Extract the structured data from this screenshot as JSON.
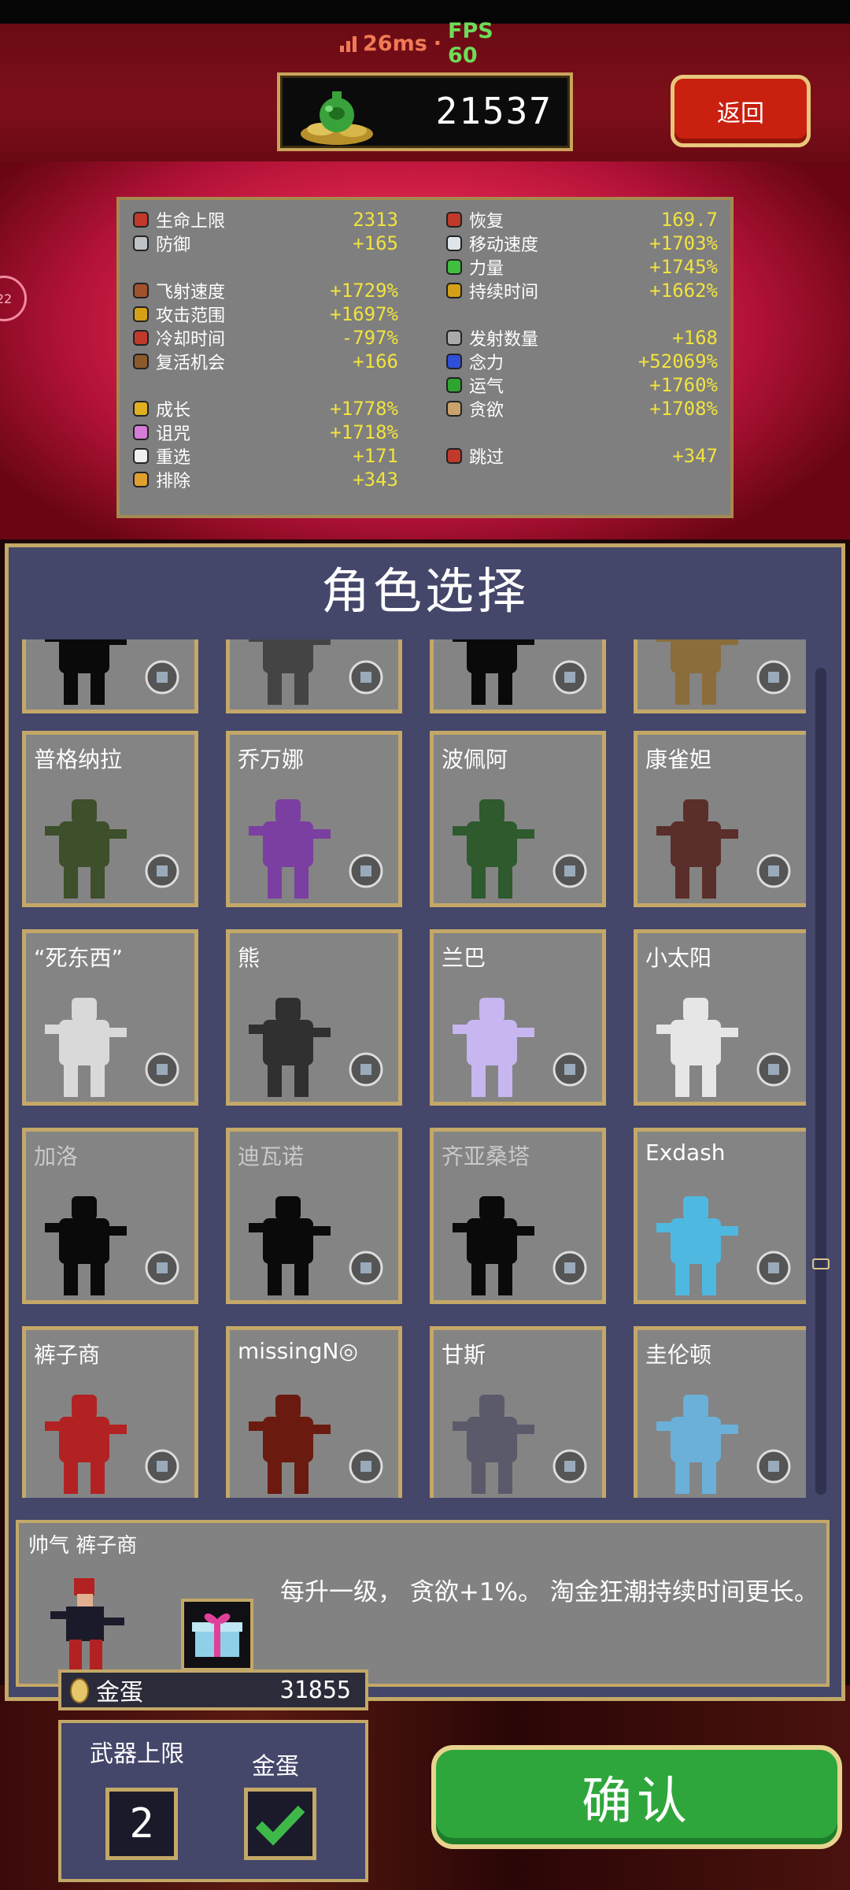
{
  "status": {
    "ping": "26ms",
    "separator": "·",
    "fps": "FPS 60"
  },
  "header": {
    "gold": "21537",
    "back_label": "返回"
  },
  "side_indicator": "22",
  "stats": {
    "left": [
      {
        "label": "生命上限",
        "value": "2313",
        "icon": "heart-cage-icon"
      },
      {
        "label": "防御",
        "value": "+165",
        "icon": "armor-icon"
      },
      {
        "label": "飞射速度",
        "value": "+1729%",
        "icon": "speed-gauntlet-icon"
      },
      {
        "label": "攻击范围",
        "value": "+1697%",
        "icon": "candelabra-icon"
      },
      {
        "label": "冷却时间",
        "value": "-797%",
        "icon": "tome-icon"
      },
      {
        "label": "复活机会",
        "value": "+166",
        "icon": "tiramisu-icon"
      },
      {
        "label": "成长",
        "value": "+1778%",
        "icon": "crown-icon"
      },
      {
        "label": "诅咒",
        "value": "+1718%",
        "icon": "skull-icon"
      },
      {
        "label": "重选",
        "value": "+171",
        "icon": "dice-icon"
      },
      {
        "label": "排除",
        "value": "+343",
        "icon": "hammer-icon"
      }
    ],
    "right": [
      {
        "label": "恢复",
        "value": "169.7",
        "icon": "pummarola-icon"
      },
      {
        "label": "移动速度",
        "value": "+1703%",
        "icon": "wings-icon"
      },
      {
        "label": "力量",
        "value": "+1745%",
        "icon": "spinach-icon"
      },
      {
        "label": "持续时间",
        "value": "+1662%",
        "icon": "spellbinder-icon"
      },
      {
        "label": "发射数量",
        "value": "+168",
        "icon": "duplicator-icon"
      },
      {
        "label": "念力",
        "value": "+52069%",
        "icon": "attractorb-icon"
      },
      {
        "label": "运气",
        "value": "+1760%",
        "icon": "clover-icon"
      },
      {
        "label": "贪欲",
        "value": "+1708%",
        "icon": "stone-mask-icon"
      },
      {
        "label": "跳过",
        "value": "+347",
        "icon": "skip-icon"
      }
    ]
  },
  "panel_title": "角色选择",
  "characters": [
    {
      "name": "",
      "locked": true,
      "item": "potion-icon",
      "color": "#111"
    },
    {
      "name": "",
      "locked": false,
      "item": "bible-icon",
      "color": "#444"
    },
    {
      "name": "",
      "locked": true,
      "item": "cross-icon",
      "color": "#111"
    },
    {
      "name": "",
      "locked": false,
      "item": "pentagram-icon",
      "color": "#8a6d3b"
    },
    {
      "name": "普格纳拉",
      "locked": false,
      "item": "pistol-icon",
      "color": "#3d4f2b"
    },
    {
      "name": "乔万娜",
      "locked": false,
      "item": "cat-icon",
      "color": "#7a3fa0"
    },
    {
      "name": "波佩阿",
      "locked": false,
      "item": "scroll-icon",
      "color": "#2e5a2e"
    },
    {
      "name": "康雀妲",
      "locked": false,
      "item": "crystal-icon",
      "color": "#5a2e2a"
    },
    {
      "name": "“死东西”",
      "locked": false,
      "item": "bone-icon",
      "color": "#d9d9d9"
    },
    {
      "name": "熊",
      "locked": false,
      "item": "shield-icon",
      "color": "#303030"
    },
    {
      "name": "兰巴",
      "locked": false,
      "item": "wheel-icon",
      "color": "#c7b6f0"
    },
    {
      "name": "小太阳",
      "locked": false,
      "item": "flower-icon",
      "color": "#e6e6e6"
    },
    {
      "name": "加洛",
      "locked": true,
      "item": "feather-icon",
      "color": "#111"
    },
    {
      "name": "迪瓦诺",
      "locked": true,
      "item": "leaf-icon",
      "color": "#111"
    },
    {
      "name": "齐亚桑塔",
      "locked": true,
      "item": "ring-icon",
      "color": "#111"
    },
    {
      "name": "Exdash",
      "locked": false,
      "item": "hat-icon",
      "color": "#4fb8e0"
    },
    {
      "name": "裤子商",
      "locked": false,
      "item": "gift-icon",
      "color": "#b22222"
    },
    {
      "name": "missingN◎",
      "locked": false,
      "item": "scythe-icon",
      "color": "#6b1a10"
    },
    {
      "name": "甘斯",
      "locked": false,
      "item": "dagger-icon",
      "color": "#5a5a6a"
    },
    {
      "name": "圭伦顿",
      "locked": false,
      "item": "dragon-icon",
      "color": "#6ab0d8"
    }
  ],
  "selected": {
    "title": "帅气 裤子商",
    "description": "每升一级， 贪欲+1%。 淘金狂潮持续时间更长。"
  },
  "footer": {
    "egg_label": "金蛋",
    "egg_count": "31855",
    "weapon_limit_label": "武器上限",
    "weapon_limit_value": "2",
    "gold_egg_label": "金蛋",
    "confirm_label": "确认"
  }
}
